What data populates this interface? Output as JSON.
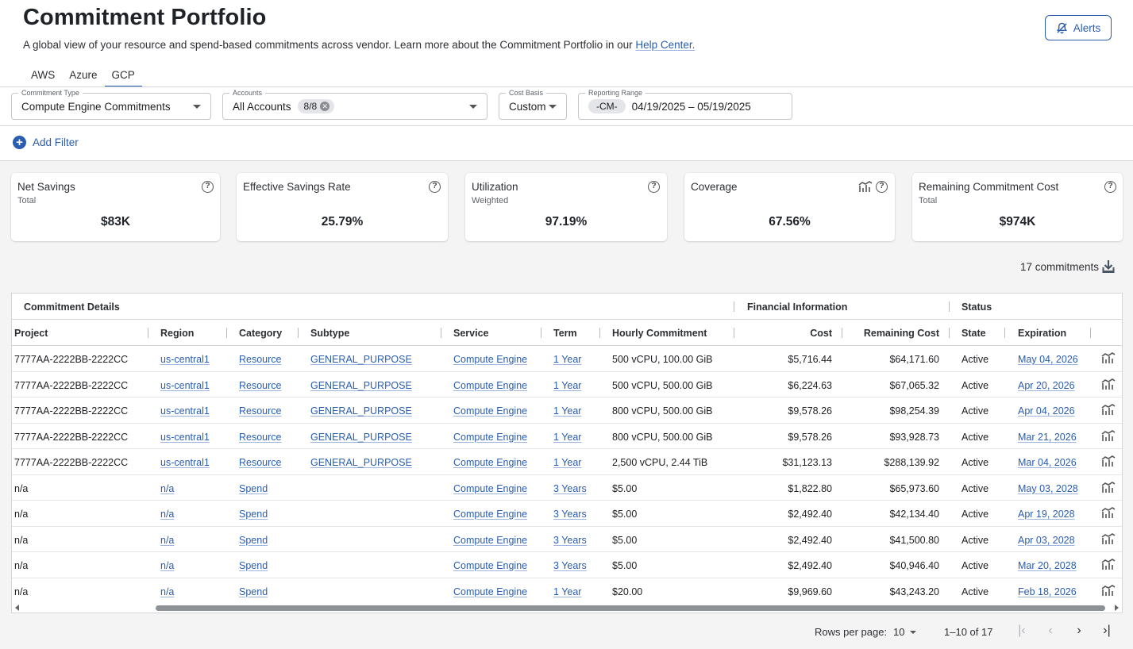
{
  "header": {
    "title": "Commitment Portfolio",
    "subtitle": "A global view of your resource and spend-based commitments across vendor. Learn more about the Commitment Portfolio in our ",
    "help_link": "Help Center.",
    "alerts_label": "Alerts"
  },
  "tabs": [
    {
      "label": "AWS",
      "active": false
    },
    {
      "label": "Azure",
      "active": false
    },
    {
      "label": "GCP",
      "active": true
    }
  ],
  "filters": {
    "commitment_type": {
      "label": "Commitment Type",
      "value": "Compute Engine Commitments"
    },
    "accounts": {
      "label": "Accounts",
      "value": "All Accounts",
      "chip": "8/8"
    },
    "cost_basis": {
      "label": "Cost Basis",
      "value": "Custom"
    },
    "reporting_range": {
      "label": "Reporting Range",
      "chip": "-CM-",
      "value": "04/19/2025 – 05/19/2025"
    },
    "add_filter": "Add Filter"
  },
  "cards": [
    {
      "title": "Net Savings",
      "sub": "Total",
      "value": "$83K"
    },
    {
      "title": "Effective Savings Rate",
      "sub": "",
      "value": "25.79%"
    },
    {
      "title": "Utilization",
      "sub": "Weighted",
      "value": "97.19%"
    },
    {
      "title": "Coverage",
      "sub": "",
      "value": "67.56%"
    },
    {
      "title": "Remaining Commitment Cost",
      "sub": "Total",
      "value": "$974K"
    }
  ],
  "commitments_count": "17 commitments",
  "table": {
    "groups": {
      "details": "Commitment Details",
      "financial": "Financial Information",
      "status": "Status"
    },
    "columns": [
      "Project",
      "Region",
      "Category",
      "Subtype",
      "Service",
      "Term",
      "Hourly Commitment",
      "Cost",
      "Remaining Cost",
      "State",
      "Expiration"
    ],
    "rows": [
      [
        "7777AA-2222BB-2222CC",
        "us-central1",
        "Resource",
        "GENERAL_PURPOSE",
        "Compute Engine",
        "1 Year",
        "500 vCPU, 100.00 GiB",
        "$5,716.44",
        "$64,171.60",
        "Active",
        "May 04, 2026"
      ],
      [
        "7777AA-2222BB-2222CC",
        "us-central1",
        "Resource",
        "GENERAL_PURPOSE",
        "Compute Engine",
        "1 Year",
        "500 vCPU, 500.00 GiB",
        "$6,224.63",
        "$67,065.32",
        "Active",
        "Apr 20, 2026"
      ],
      [
        "7777AA-2222BB-2222CC",
        "us-central1",
        "Resource",
        "GENERAL_PURPOSE",
        "Compute Engine",
        "1 Year",
        "800 vCPU, 500.00 GiB",
        "$9,578.26",
        "$98,254.39",
        "Active",
        "Apr 04, 2026"
      ],
      [
        "7777AA-2222BB-2222CC",
        "us-central1",
        "Resource",
        "GENERAL_PURPOSE",
        "Compute Engine",
        "1 Year",
        "800 vCPU, 500.00 GiB",
        "$9,578.26",
        "$93,928.73",
        "Active",
        "Mar 21, 2026"
      ],
      [
        "7777AA-2222BB-2222CC",
        "us-central1",
        "Resource",
        "GENERAL_PURPOSE",
        "Compute Engine",
        "1 Year",
        "2,500 vCPU, 2.44 TiB",
        "$31,123.13",
        "$288,139.92",
        "Active",
        "Mar 04, 2026"
      ],
      [
        "n/a",
        "n/a",
        "Spend",
        "",
        "Compute Engine",
        "3 Years",
        "$5.00",
        "$1,822.80",
        "$65,973.60",
        "Active",
        "May 03, 2028"
      ],
      [
        "n/a",
        "n/a",
        "Spend",
        "",
        "Compute Engine",
        "3 Years",
        "$5.00",
        "$2,492.40",
        "$42,134.40",
        "Active",
        "Apr 19, 2028"
      ],
      [
        "n/a",
        "n/a",
        "Spend",
        "",
        "Compute Engine",
        "3 Years",
        "$5.00",
        "$2,492.40",
        "$41,500.80",
        "Active",
        "Apr 03, 2028"
      ],
      [
        "n/a",
        "n/a",
        "Spend",
        "",
        "Compute Engine",
        "3 Years",
        "$5.00",
        "$2,492.40",
        "$40,946.40",
        "Active",
        "Mar 20, 2028"
      ],
      [
        "n/a",
        "n/a",
        "Spend",
        "",
        "Compute Engine",
        "1 Year",
        "$20.00",
        "$9,969.60",
        "$43,243.20",
        "Active",
        "Feb 18, 2026"
      ]
    ]
  },
  "pagination": {
    "rows_per_page_label": "Rows per page:",
    "rows_per_page": "10",
    "range": "1–10 of 17"
  },
  "colors": {
    "accent": "#2a5db0",
    "background": "#f4f4f5"
  }
}
